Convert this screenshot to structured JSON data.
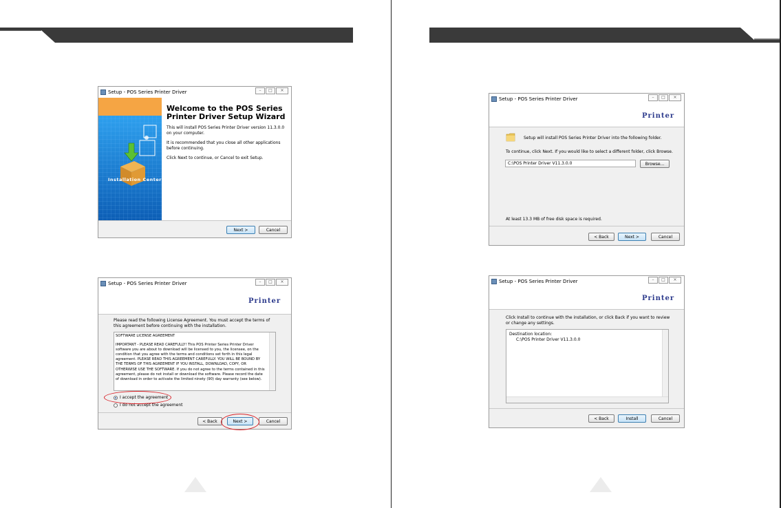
{
  "dialogs": {
    "welcome": {
      "title": "Setup - POS Series Printer Driver",
      "heading": "Welcome to the POS Series Printer Driver Setup Wizard",
      "p1": "This will install POS Series Printer Driver version 11.3.0.0 on your computer.",
      "p2": "It is recommended that you close all other applications before continuing.",
      "p3": "Click Next to continue, or Cancel to exit Setup.",
      "banner_caption": "Installation Center",
      "next": "Next >",
      "cancel": "Cancel"
    },
    "license": {
      "title": "Setup - POS Series Printer Driver",
      "brand": "Printer",
      "intro": "Please read the following License Agreement. You must accept the terms of this agreement before continuing with the installation.",
      "license_heading": "SOFTWARE LICENSE AGREEMENT",
      "license_body": "IMPORTANT - PLEASE READ CAREFULLY!  This POS Printer Series Printer Driver software you are about to download will be licensed to you, the licensee, on the condition that you agree with the terms and conditions set forth in this legal agreement.  PLEASE READ THIS AGREEMENT CAREFULLY.  YOU WILL BE BOUND BY THE TERMS OF THIS AGREEMENT IF YOU INSTALL, DOWNLOAD, COPY, OR OTHERWISE USE THE SOFTWARE.  If you do not agree to the terms contained in this agreement, please do not install or download the software.  Please record the date of download in order to activate the limited ninety (90) day warranty (see below).",
      "accept": "I accept the agreement",
      "decline": "I do not accept the agreement",
      "back": "< Back",
      "next": "Next >",
      "cancel": "Cancel"
    },
    "folder": {
      "title": "Setup - POS Series Printer Driver",
      "brand": "Printer",
      "info": "Setup will install POS Series Printer Driver into the following folder.",
      "instruction": "To continue, click Next. If you would like to select a different folder, click Browse.",
      "path": "C:\\POS Printer Driver V11.3.0.0",
      "browse": "Browse...",
      "space": "At least 13.3 MB of free disk space is required.",
      "back": "< Back",
      "next": "Next >",
      "cancel": "Cancel"
    },
    "ready": {
      "title": "Setup - POS Series Printer Driver",
      "brand": "Printer",
      "info": "Click Install to continue with the installation, or click Back if you want to review or change any settings.",
      "dest_label": "Destination location:",
      "dest_path": "C:\\POS Printer Driver V11.3.0.0",
      "back": "< Back",
      "install": "Install",
      "cancel": "Cancel"
    }
  },
  "colors": {
    "header_band": "#3a3a3a",
    "banner_orange": "#f5a544",
    "banner_blue": "#1f7fd0",
    "brand_text": "#2c3a8c",
    "highlight_oval": "#d9242a"
  },
  "icons": [
    "setup-app-icon",
    "folder-icon",
    "install-box-icon",
    "page-turn-triangle-icon"
  ]
}
